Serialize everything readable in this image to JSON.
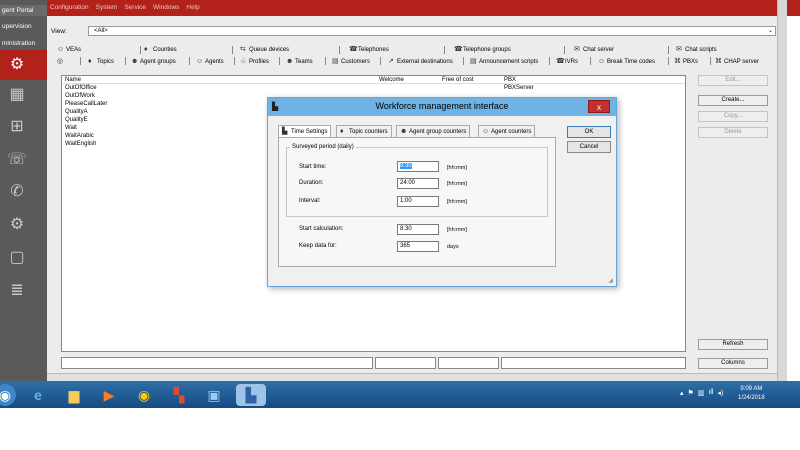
{
  "sidebar": {
    "tabs": [
      {
        "label": "gent Portal"
      },
      {
        "label": "upervision"
      },
      {
        "label": "ministration"
      }
    ],
    "icons": [
      "gear-icon",
      "table-gear-icon",
      "hierarchy-gear-icon",
      "phone-gear-icon",
      "phone-icon",
      "user-gear-icon",
      "document-gear-icon",
      "list-gear-icon"
    ]
  },
  "menu": {
    "items": [
      "Configuration",
      "System",
      "Service",
      "Windows",
      "Help"
    ]
  },
  "view": {
    "label": "View:",
    "value": "<All>"
  },
  "toolbar": {
    "row1": [
      {
        "label": "VEAs"
      },
      {
        "label": "Counties"
      },
      {
        "label": "Queue devices"
      },
      {
        "label": "Telephones"
      },
      {
        "label": "Telephone groups"
      },
      {
        "label": "Chat server"
      },
      {
        "label": "Chat scripts"
      }
    ],
    "row2": [
      {
        "label": "Topics"
      },
      {
        "label": "Agent groups"
      },
      {
        "label": "Agents"
      },
      {
        "label": "Profiles"
      },
      {
        "label": "Teams"
      },
      {
        "label": "Customers"
      },
      {
        "label": "External destinations"
      },
      {
        "label": "Announcement scripts"
      },
      {
        "label": "IVRs"
      },
      {
        "label": "Break Time codes"
      },
      {
        "label": "PBXs"
      },
      {
        "label": "CHAP server"
      }
    ]
  },
  "list": {
    "columns": [
      "Name",
      "Welcome",
      "Free of cost",
      "PBX"
    ],
    "rows": [
      {
        "name": "OutOfOffice",
        "welcome": "",
        "free": "",
        "pbx": "PBXServer"
      },
      {
        "name": "OutOfWork",
        "welcome": "",
        "free": "",
        "pbx": ""
      },
      {
        "name": "PleaseCallLater",
        "welcome": "",
        "free": "",
        "pbx": ""
      },
      {
        "name": "QualityA",
        "welcome": "",
        "free": "",
        "pbx": ""
      },
      {
        "name": "QualityE",
        "welcome": "",
        "free": "",
        "pbx": ""
      },
      {
        "name": "Wait",
        "welcome": "",
        "free": "",
        "pbx": ""
      },
      {
        "name": "WaitArabic",
        "welcome": "",
        "free": "",
        "pbx": ""
      },
      {
        "name": "WaitEnglish",
        "welcome": "",
        "free": "",
        "pbx": ""
      }
    ]
  },
  "buttons": {
    "edit": "Edit...",
    "create": "Create...",
    "copy": "Copy...",
    "delete": "Delete",
    "refresh": "Refresh",
    "columns": "Columns"
  },
  "dialog": {
    "title": "Workforce management interface",
    "close": "x",
    "tabs": [
      {
        "label": "Time Settings"
      },
      {
        "label": "Topic counters"
      },
      {
        "label": "Agent group counters"
      },
      {
        "label": "Agent counters"
      }
    ],
    "group_title": "Surveyed period (daily)",
    "fields": {
      "start_time": {
        "label": "Start time:",
        "value": "8:30",
        "unit": "[hh:mm]"
      },
      "duration": {
        "label": "Duration:",
        "value": "24:00",
        "unit": "[hh:mm]"
      },
      "interval": {
        "label": "Interval:",
        "value": "1:00",
        "unit": "[hh:mm]"
      },
      "start_calculation": {
        "label": "Start calculation:",
        "value": "8:30",
        "unit": "[hh:mm]"
      },
      "keep_data": {
        "label": "Keep data for:",
        "value": "365",
        "unit": "days"
      }
    },
    "ok": "OK",
    "cancel": "Cancel"
  },
  "taskbar": {
    "time": "9:09 AM",
    "date": "1/24/2018"
  },
  "colors": {
    "topbar": "#b3211b",
    "sidebar": "#5a5a5a",
    "dialog_title": "#6fb3e6",
    "close_button": "#c4302b",
    "taskbar": "#1f5a93"
  }
}
